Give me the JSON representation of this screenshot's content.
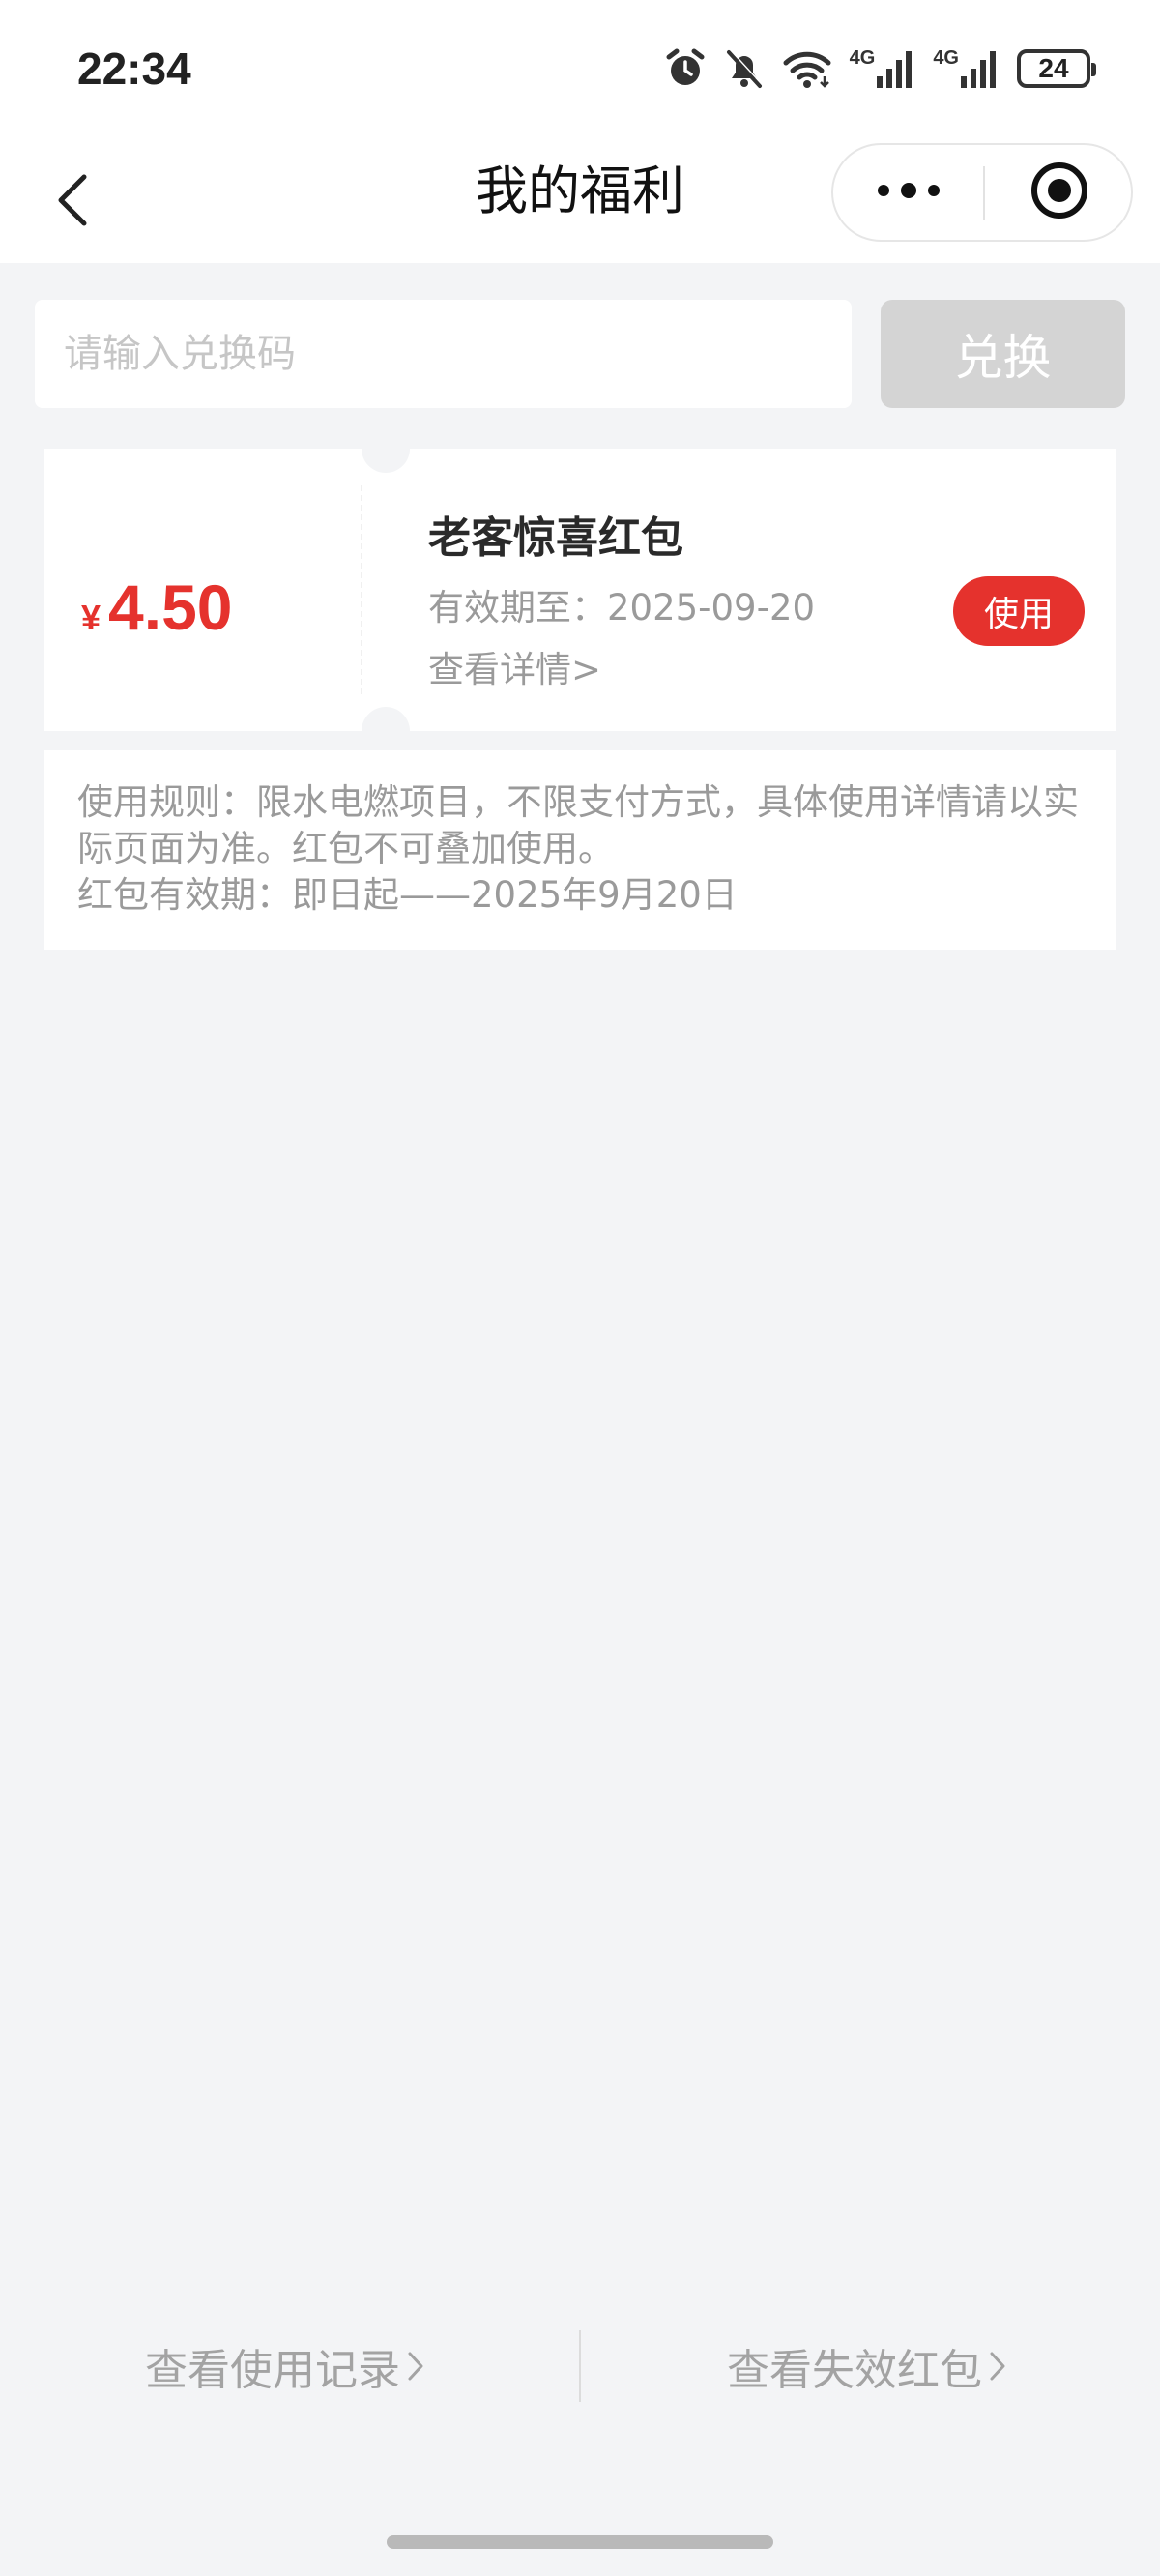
{
  "status_bar": {
    "time": "22:34",
    "network_1": "4G",
    "network_2": "4G",
    "battery": "24",
    "icons": [
      "alarm-icon",
      "bell-muted-icon",
      "wifi-icon",
      "signal-icon",
      "signal-icon",
      "battery-icon"
    ]
  },
  "nav": {
    "title": "我的福利",
    "back_icon": "chevron-left-icon",
    "more_icon": "more-dots-icon",
    "close_icon": "target-circle-icon"
  },
  "redeem": {
    "placeholder": "请输入兑换码",
    "button_label": "兑换"
  },
  "coupon": {
    "currency": "¥",
    "amount": "4.50",
    "title": "老客惊喜红包",
    "expiry": "有效期至：2025-09-20",
    "detail_link": "查看详情>",
    "use_label": "使用",
    "accent_color": "#e5322d"
  },
  "rules": {
    "line_1": "使用规则：限水电燃项目，不限支付方式，具体使用详情请以实际页面为准。红包不可叠加使用。",
    "line_2": "红包有效期：即日起——2025年9月20日"
  },
  "bottom": {
    "usage_record_label": "查看使用记录",
    "expired_label": "查看失效红包"
  }
}
